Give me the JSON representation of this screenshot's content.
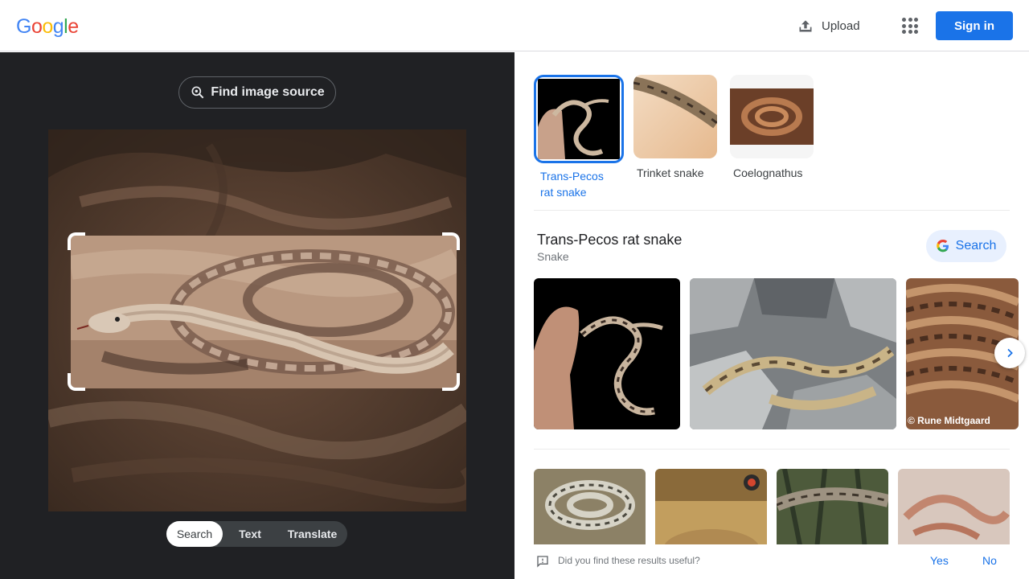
{
  "header": {
    "logo_letters": [
      {
        "ch": "G",
        "color": "#4285f4"
      },
      {
        "ch": "o",
        "color": "#ea4335"
      },
      {
        "ch": "o",
        "color": "#fbbc05"
      },
      {
        "ch": "g",
        "color": "#4285f4"
      },
      {
        "ch": "l",
        "color": "#34a853"
      },
      {
        "ch": "e",
        "color": "#ea4335"
      }
    ],
    "upload_label": "Upload",
    "signin_label": "Sign in"
  },
  "left": {
    "find_source_label": "Find image source",
    "modes": [
      {
        "label": "Search",
        "active": true
      },
      {
        "label": "Text",
        "active": false
      },
      {
        "label": "Translate",
        "active": false
      }
    ]
  },
  "right": {
    "matches": [
      {
        "label": "Trans-Pecos rat snake",
        "selected": true
      },
      {
        "label": "Trinket snake",
        "selected": false
      },
      {
        "label": "Coelognathus",
        "selected": false
      }
    ],
    "entity": {
      "title": "Trans-Pecos rat snake",
      "subtitle": "Snake",
      "search_label": "Search"
    },
    "watermark": "© Rune Midtgaard",
    "feedback": {
      "question": "Did you find these results useful?",
      "yes": "Yes",
      "no": "No"
    }
  },
  "colors": {
    "accent": "#1a73e8",
    "dark_panel": "#202124"
  }
}
